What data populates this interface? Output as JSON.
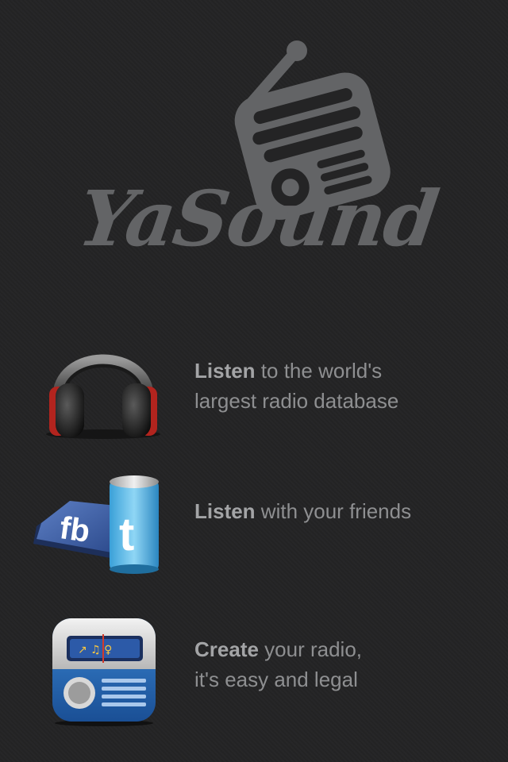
{
  "logo": {
    "text": "YaSound",
    "color": "#636466"
  },
  "features": [
    {
      "icon": "headphones-icon",
      "bold": "Listen",
      "line1_rest": " to the world's",
      "line2": "largest radio database"
    },
    {
      "icon": "facebook-twitter-icon",
      "bold": "Listen",
      "line1_rest": " with your friends",
      "line2": ""
    },
    {
      "icon": "radio-app-icon",
      "bold": "Create",
      "line1_rest": " your radio,",
      "line2": "it's easy and legal"
    }
  ],
  "colors": {
    "background": "#242425",
    "text": "#8e8f91",
    "text_bold": "#a3a4a6"
  }
}
